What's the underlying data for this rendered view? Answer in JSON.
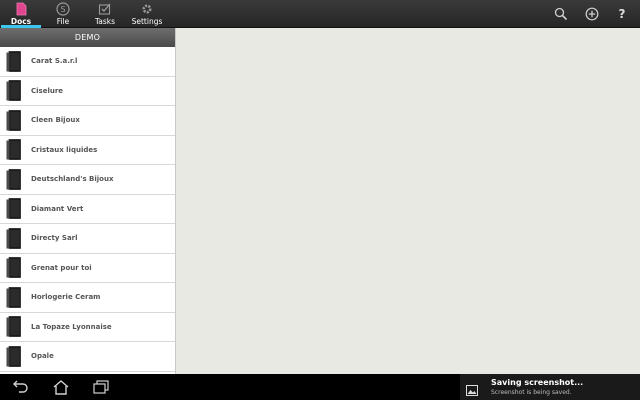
{
  "topbar": {
    "tabs": [
      {
        "label": "Docs",
        "icon": "docs-icon",
        "active": true
      },
      {
        "label": "File",
        "icon": "file-icon",
        "active": false
      },
      {
        "label": "Tasks",
        "icon": "tasks-icon",
        "active": false
      },
      {
        "label": "Settings",
        "icon": "settings-icon",
        "active": false
      }
    ],
    "actions": [
      "search-icon",
      "add-icon",
      "help-icon"
    ],
    "help_label": "?",
    "accent_color": "#3cc6ee",
    "docs_icon_color": "#e0458f"
  },
  "panel": {
    "header": "DEMO",
    "items": [
      {
        "label": "Carat S.a.r.l"
      },
      {
        "label": "Ciselure"
      },
      {
        "label": "Cleen Bijoux"
      },
      {
        "label": "Cristaux liquides"
      },
      {
        "label": "Deutschland's Bijoux"
      },
      {
        "label": "Diamant Vert"
      },
      {
        "label": "Directy Sarl"
      },
      {
        "label": "Grenat pour toi"
      },
      {
        "label": "Horlogerie Ceram"
      },
      {
        "label": "La Topaze Lyonnaise"
      },
      {
        "label": "Opale"
      }
    ]
  },
  "navbar": {
    "buttons": [
      "back-icon",
      "home-icon",
      "recent-apps-icon"
    ]
  },
  "notification": {
    "title": "Saving screenshot...",
    "subtitle": "Screenshot is being saved.",
    "icon": "image-icon"
  }
}
